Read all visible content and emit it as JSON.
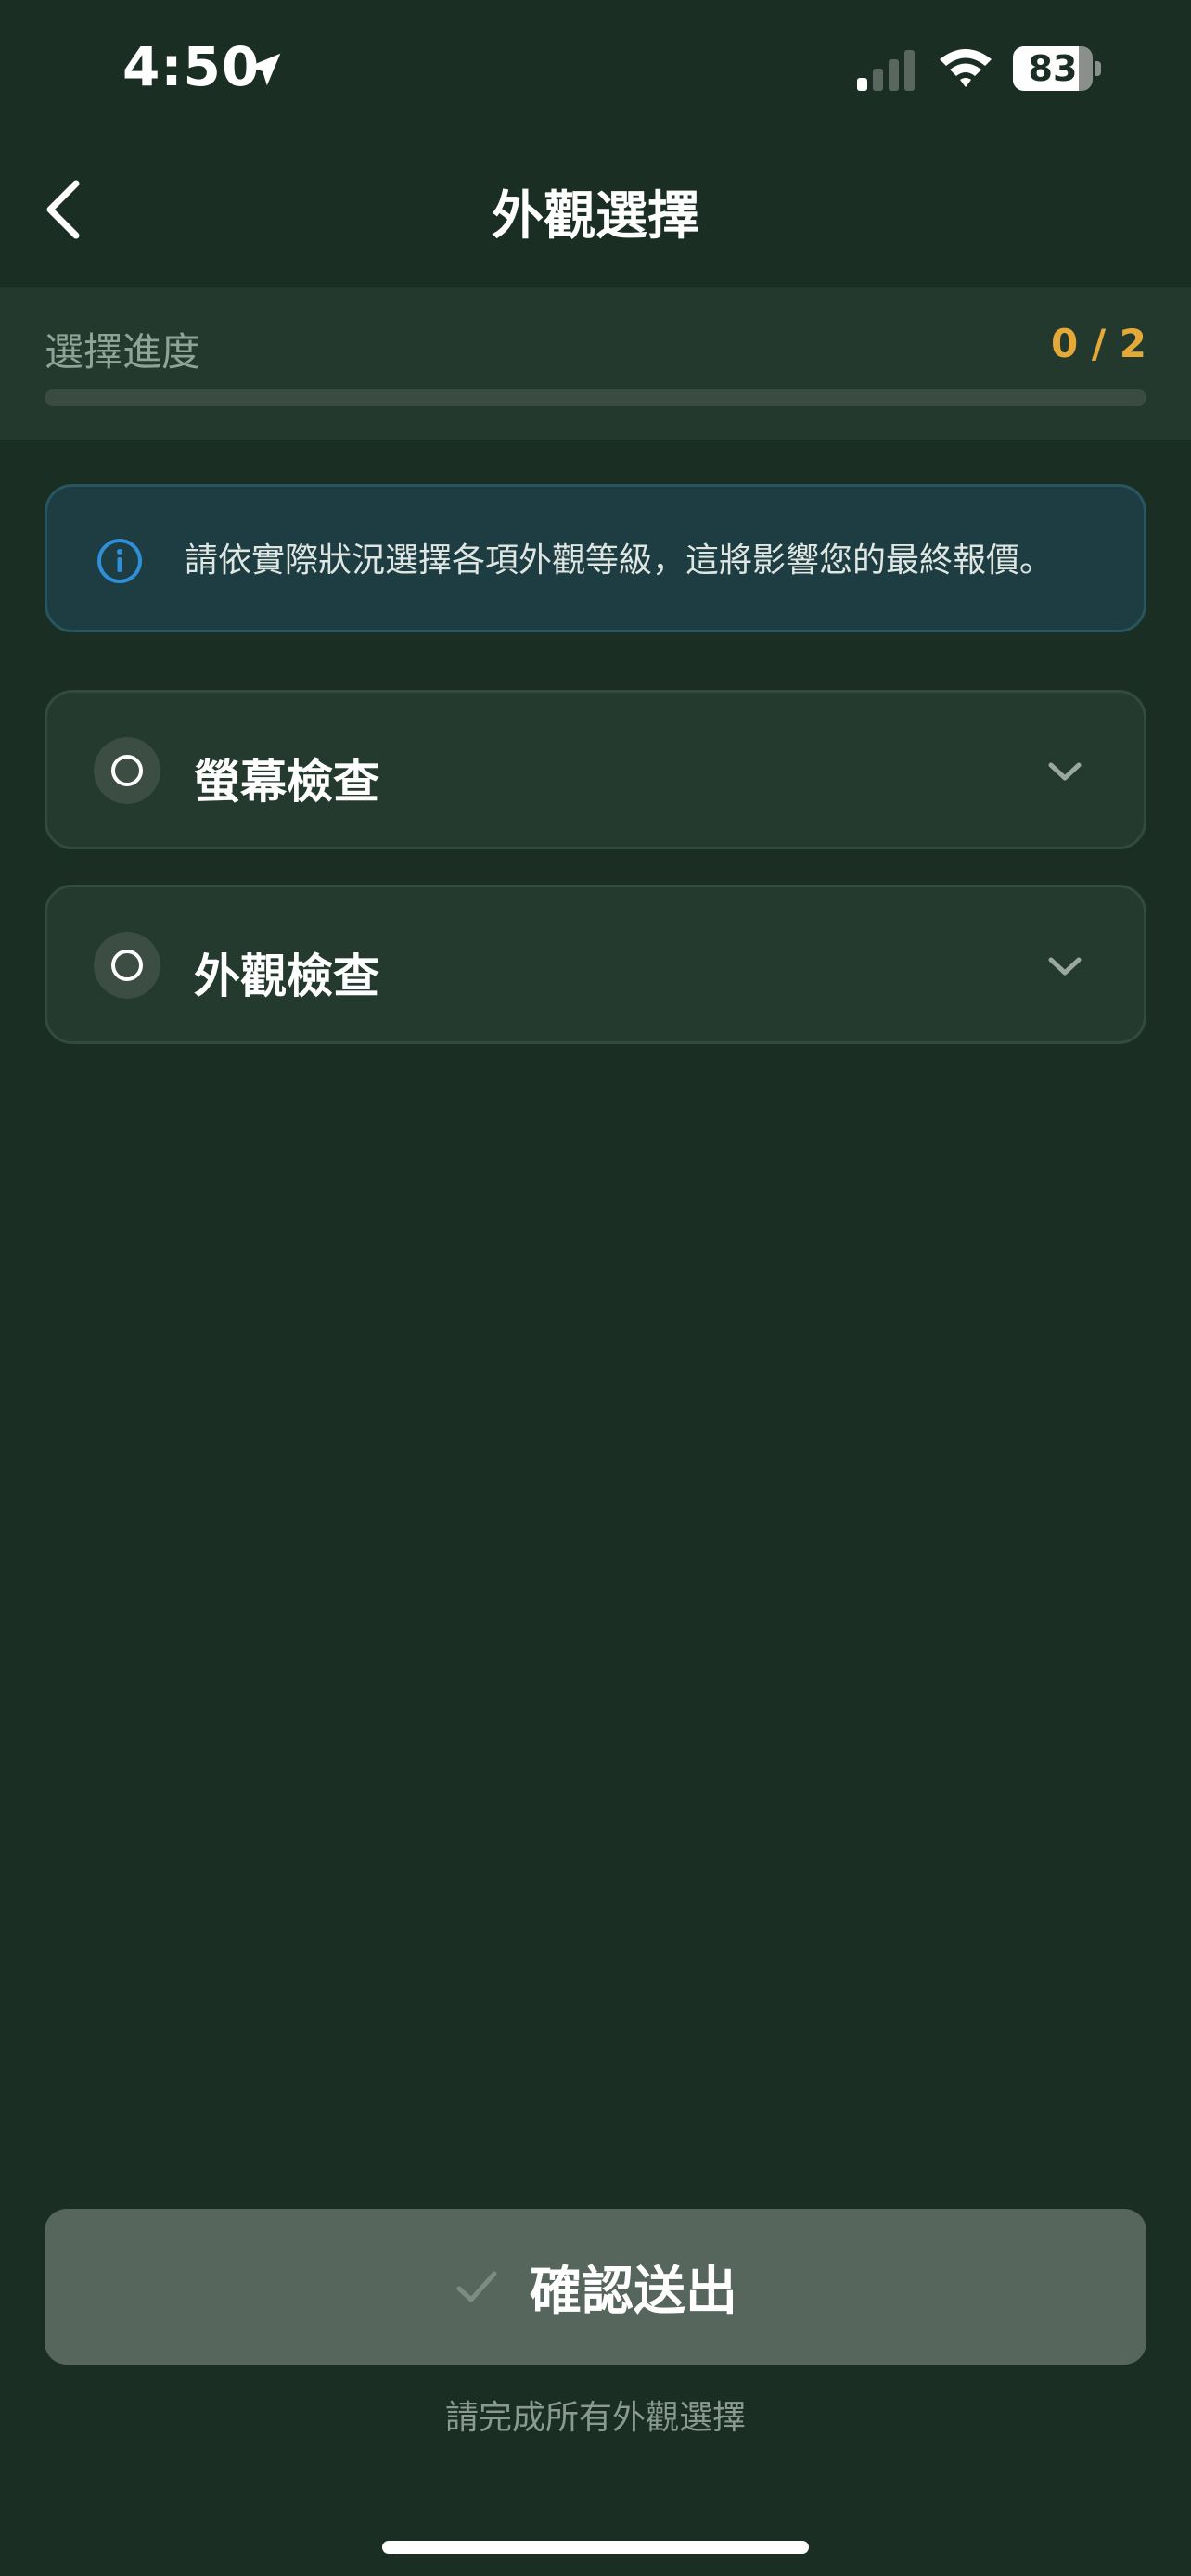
{
  "status_bar": {
    "time": "4:50",
    "battery": 83,
    "battery_label": "83",
    "icons": [
      "location-arrow-icon",
      "cellular-signal-icon",
      "wifi-icon",
      "battery-icon"
    ]
  },
  "nav": {
    "title": "外觀選擇",
    "back_icon": "chevron-left-icon"
  },
  "progress": {
    "label": "選擇進度",
    "count": "0 / 2",
    "completed": 0,
    "total": 2,
    "fill_color": "#e5a93a"
  },
  "info": {
    "icon": "info-icon",
    "text": "請依實際狀況選擇各項外觀等級，這將影響您的最終報價。",
    "accent": "#2f8fd8"
  },
  "items": [
    {
      "label": "螢幕檢查",
      "status_icon": "radio-empty-icon",
      "expand_icon": "chevron-down-icon"
    },
    {
      "label": "外觀檢查",
      "status_icon": "radio-empty-icon",
      "expand_icon": "chevron-down-icon"
    }
  ],
  "confirm": {
    "label": "確認送出",
    "icon": "checkmark-icon",
    "hint": "請完成所有外觀選擇",
    "enabled": false
  },
  "colors": {
    "background": "#1b2e24",
    "card": "#243a2f",
    "accent_orange": "#e5a93a",
    "button_disabled": "#56665d"
  }
}
